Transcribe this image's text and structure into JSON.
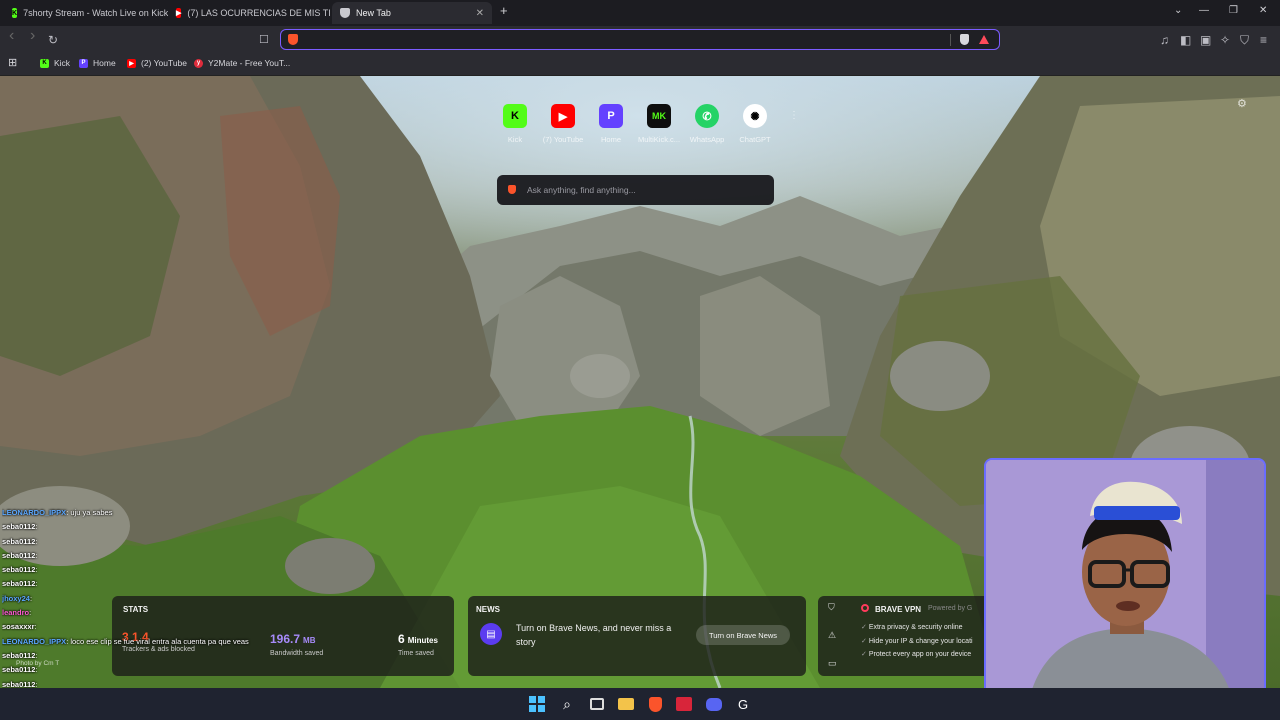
{
  "tabs": [
    {
      "title": "7shorty Stream - Watch Live on Kick",
      "favicon": "kick-icon",
      "active": false
    },
    {
      "title": "(7) LAS OCURRENCIAS DE MIS TIOS",
      "favicon": "youtube-icon",
      "active": false
    },
    {
      "title": "New Tab",
      "favicon": "brave-shield-icon",
      "active": true
    }
  ],
  "new_tab_label": "+",
  "window_controls": {
    "tab_search": "⌄",
    "minimize": "—",
    "restore": "❐",
    "close": "✕"
  },
  "toolbar": {
    "back": "‹",
    "forward": "›",
    "reload": "↻",
    "bookmark": "☐",
    "address_value": ""
  },
  "bookmarks": [
    {
      "label": "Kick",
      "icon": "kick-icon"
    },
    {
      "label": "Home",
      "icon": "home-icon"
    },
    {
      "label": "(2) YouTube",
      "icon": "youtube-icon"
    },
    {
      "label": "Y2Mate - Free YouT...",
      "icon": "y2mate-icon"
    }
  ],
  "top_sites": [
    {
      "label": "Kick",
      "icon": "K",
      "color": "#53fc18",
      "fg": "#000000"
    },
    {
      "label": "(7) YouTube",
      "icon": "▶",
      "color": "#ff0000",
      "fg": "#ffffff"
    },
    {
      "label": "Home",
      "icon": "P",
      "color": "#6441ff",
      "fg": "#ffffff"
    },
    {
      "label": "MultiKick.c...",
      "icon": "MK",
      "color": "#0e0e0e",
      "fg": "#53fc18"
    },
    {
      "label": "WhatsApp",
      "icon": "✆",
      "color": "#25d366",
      "fg": "#ffffff"
    },
    {
      "label": "ChatGPT",
      "icon": "✺",
      "color": "#ffffff",
      "fg": "#000000"
    }
  ],
  "search": {
    "placeholder": "Ask anything, find anything..."
  },
  "stats": {
    "title": "STATS",
    "trackers_value": "3 1 4",
    "trackers_label": "Trackers & ads blocked",
    "bandwidth_value": "196.7",
    "bandwidth_unit": "MB",
    "bandwidth_label": "Bandwidth saved",
    "time_value": "6",
    "time_unit": "Minutes",
    "time_label": "Time saved"
  },
  "news": {
    "title": "NEWS",
    "text": "Turn on Brave News, and never miss a story",
    "button": "Turn on Brave News"
  },
  "vpn": {
    "title": "BRAVE VPN",
    "powered": "Powered by G",
    "items": [
      "Extra privacy & security online",
      "Hide your IP & change your locati",
      "Protect every app on your device"
    ]
  },
  "photo_credit": "Photo by Cm T",
  "chat": [
    {
      "user": "LEONARDO_IPPX",
      "msg": ": uju ya sabes",
      "color": "#5aa7ff"
    },
    {
      "user": "seba0112",
      "msg": ":",
      "color": "#ffffff"
    },
    {
      "user": "seba0112",
      "msg": ":",
      "color": "#ffffff"
    },
    {
      "user": "seba0112",
      "msg": ":",
      "color": "#ffffff"
    },
    {
      "user": "seba0112",
      "msg": ":",
      "color": "#ffffff"
    },
    {
      "user": "seba0112",
      "msg": ":",
      "color": "#ffffff"
    },
    {
      "user": "jhoxy24",
      "msg": ":",
      "color": "#5aa7ff"
    },
    {
      "user": "leandro",
      "msg": ":",
      "color": "#ff5ad1"
    },
    {
      "user": "sosaxxxr",
      "msg": ":",
      "color": "#ffffff"
    },
    {
      "user": "LEONARDO_IPPX",
      "msg": ": loco ese clip se fue viral entra ala cuenta pa que veas",
      "color": "#5aa7ff"
    },
    {
      "user": "seba0112",
      "msg": ":",
      "color": "#ffffff"
    },
    {
      "user": "seba0112",
      "msg": ":",
      "color": "#ffffff"
    },
    {
      "user": "seba0112",
      "msg": ":",
      "color": "#ffffff"
    },
    {
      "user": "seba0112",
      "msg": ":",
      "color": "#ffffff"
    },
    {
      "user": "seba0112",
      "msg": ":",
      "color": "#ffffff"
    }
  ]
}
